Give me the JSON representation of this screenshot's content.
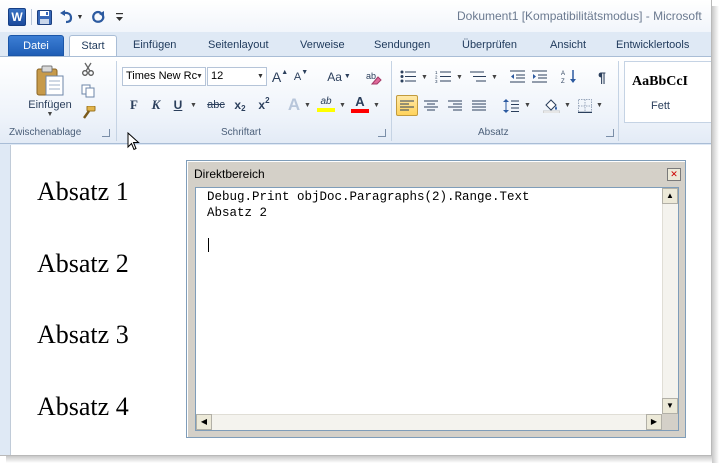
{
  "window": {
    "title": "Dokument1 [Kompatibilitätsmodus]  -  Microsoft"
  },
  "quick_access": {
    "app_icon_letter": "W",
    "icons": [
      "word-app-icon",
      "save-icon",
      "undo-icon",
      "redo-icon",
      "customize-qat-icon"
    ]
  },
  "tabs": {
    "datei": "Datei",
    "start": "Start",
    "einfuegen": "Einfügen",
    "seitenlayout": "Seitenlayout",
    "verweise": "Verweise",
    "sendungen": "Sendungen",
    "ueberpruefen": "Überprüfen",
    "ansicht": "Ansicht",
    "entwicklertools": "Entwicklertools"
  },
  "ribbon": {
    "clipboard": {
      "paste_label": "Einfügen",
      "group_label": "Zwischenablage"
    },
    "font": {
      "font_name": "Times New Rc",
      "font_size": "12",
      "grow_font": "A",
      "shrink_font": "A",
      "change_case": "Aa",
      "bold": "F",
      "italic": "K",
      "underline": "U",
      "strikethrough": "abc",
      "subscript": "x",
      "subscript_mark": "2",
      "superscript": "x",
      "superscript_mark": "2",
      "text_effects": "A",
      "highlight": "ab",
      "font_color": "A",
      "group_label": "Schriftart"
    },
    "paragraph": {
      "show_marks": "¶",
      "group_label": "Absatz"
    },
    "styles": {
      "style_preview": "AaBbCcI",
      "style_name": "Fett"
    },
    "colors": {
      "highlight": "#ffff00",
      "font_color": "#ff0000",
      "accent": "#1f5eb6"
    }
  },
  "document": {
    "paragraphs": [
      "Absatz 1",
      "Absatz 2",
      "Absatz 3",
      "Absatz 4"
    ]
  },
  "immediate_window": {
    "title": "Direktbereich",
    "lines": [
      "Debug.Print objDoc.Paragraphs(2).Range.Text",
      "Absatz 2"
    ]
  }
}
